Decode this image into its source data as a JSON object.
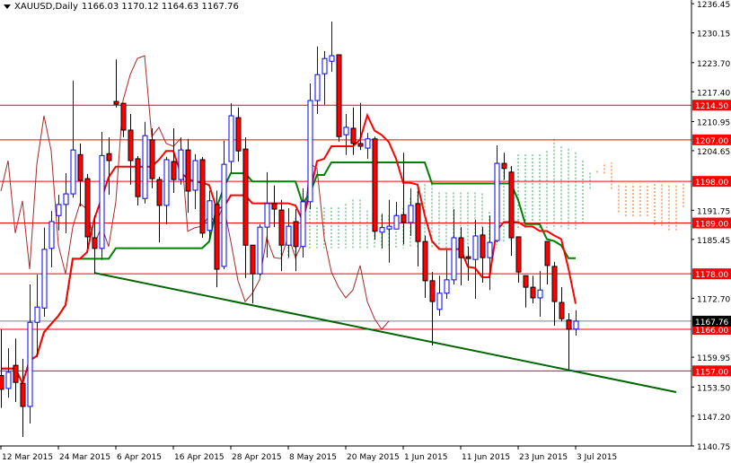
{
  "header": {
    "symbol": "XAUUSD,Daily",
    "ohlc_text": "1166.03 1170.12 1164.63 1167.76"
  },
  "colors": {
    "bull": "#0000ff",
    "bear": "#ff0000",
    "tenkan": "#ff0000",
    "kijun": "#008000",
    "chikou": "#a52a2a",
    "cloud_bear": "#ff6600",
    "cloud_bull": "#33aa55",
    "level": "#ff0000",
    "trendline": "#006400",
    "price_line": "#708090"
  },
  "chart_data": {
    "type": "candlestick",
    "title": "XAUUSD,Daily",
    "ylim": [
      1140.75,
      1236.45
    ],
    "y_ticks": [
      "1236.45",
      "1230.15",
      "1223.70",
      "1217.40",
      "1210.95",
      "1204.65",
      "1191.75",
      "1185.45",
      "1172.70",
      "1159.95",
      "1153.50",
      "1147.20",
      "1140.75"
    ],
    "x_ticks": [
      {
        "bar": 0,
        "label": "12 Mar 2015"
      },
      {
        "bar": 8,
        "label": "24 Mar 2015"
      },
      {
        "bar": 16,
        "label": "6 Apr 2015"
      },
      {
        "bar": 24,
        "label": "16 Apr 2015"
      },
      {
        "bar": 32,
        "label": "28 Apr 2015"
      },
      {
        "bar": 40,
        "label": "8 May 2015"
      },
      {
        "bar": 48,
        "label": "20 May 2015"
      },
      {
        "bar": 56,
        "label": "1 Jun 2015"
      },
      {
        "bar": 64,
        "label": "11 Jun 2015"
      },
      {
        "bar": 72,
        "label": "23 Jun 2015"
      },
      {
        "bar": 80,
        "label": "3 Jul 2015"
      }
    ],
    "levels": [
      "1214.50",
      "1207.00",
      "1198.00",
      "1189.00",
      "1178.00",
      "1166.00",
      "1157.00"
    ],
    "current_price": "1167.76",
    "trendline": {
      "from": [
        13,
        1178.2
      ],
      "to": [
        94,
        1152.4
      ]
    },
    "ohlc": [
      [
        1156,
        1166,
        1149,
        1153
      ],
      [
        1153.2,
        1161.9,
        1151.2,
        1156.7
      ],
      [
        1158.2,
        1164,
        1150.3,
        1154.5
      ],
      [
        1154.3,
        1159.6,
        1142.7,
        1149.3
      ],
      [
        1149.3,
        1175.7,
        1145.6,
        1167.5
      ],
      [
        1167.5,
        1177.8,
        1160,
        1170.8
      ],
      [
        1170.6,
        1188,
        1168.7,
        1183.3
      ],
      [
        1183.5,
        1191.6,
        1179.4,
        1189.3
      ],
      [
        1190.6,
        1195.1,
        1187.4,
        1193
      ],
      [
        1193,
        1199.8,
        1186.8,
        1195.3
      ],
      [
        1195.3,
        1219.8,
        1194.5,
        1204.8
      ],
      [
        1203.8,
        1206.2,
        1192.6,
        1198.2
      ],
      [
        1198.6,
        1199.6,
        1183.5,
        1186
      ],
      [
        1185.8,
        1190.6,
        1178,
        1183.5
      ],
      [
        1183.5,
        1208.7,
        1181,
        1203.6
      ],
      [
        1204,
        1207.5,
        1195.1,
        1202.5
      ],
      [
        1215.3,
        1224.4,
        1214,
        1214.7
      ],
      [
        1214.9,
        1214.9,
        1207.6,
        1209.1
      ],
      [
        1209.1,
        1212.6,
        1197.3,
        1202.5
      ],
      [
        1202.9,
        1203.5,
        1192.8,
        1194.7
      ],
      [
        1194.3,
        1210.9,
        1193.2,
        1207.9
      ],
      [
        1207,
        1209.5,
        1196.5,
        1198.6
      ],
      [
        1198.4,
        1199,
        1184.8,
        1192.8
      ],
      [
        1192.8,
        1203.3,
        1188.7,
        1202.7
      ],
      [
        1202.3,
        1209.5,
        1195.5,
        1198.4
      ],
      [
        1198.4,
        1207.5,
        1197.3,
        1204.8
      ],
      [
        1204.8,
        1207.2,
        1191.2,
        1195.9
      ],
      [
        1196.1,
        1203.9,
        1192,
        1202.5
      ],
      [
        1202.7,
        1203.3,
        1185.8,
        1186.8
      ],
      [
        1187.4,
        1196,
        1185.4,
        1193.8
      ],
      [
        1193,
        1196,
        1175.1,
        1179
      ],
      [
        1179.6,
        1206.8,
        1179,
        1201.7
      ],
      [
        1202.3,
        1214.9,
        1199.8,
        1212.2
      ],
      [
        1211.8,
        1214,
        1202.3,
        1204.6
      ],
      [
        1205,
        1207.5,
        1177.1,
        1184.2
      ],
      [
        1184.2,
        1184.2,
        1171.6,
        1178
      ],
      [
        1178,
        1188.7,
        1177.6,
        1188.1
      ],
      [
        1188.1,
        1200,
        1181.5,
        1193.2
      ],
      [
        1193.2,
        1197.1,
        1188.1,
        1192
      ],
      [
        1191.8,
        1194,
        1178.6,
        1184.2
      ],
      [
        1184.2,
        1192.2,
        1181.5,
        1188.3
      ],
      [
        1189.3,
        1192,
        1178.6,
        1183.9
      ],
      [
        1183.9,
        1196.5,
        1181.5,
        1193.6
      ],
      [
        1193.6,
        1219.2,
        1192,
        1215.5
      ],
      [
        1215.5,
        1227.2,
        1212.6,
        1221.1
      ],
      [
        1221.3,
        1226.2,
        1214.6,
        1224.6
      ],
      [
        1224,
        1232.6,
        1221.7,
        1225.2
      ],
      [
        1225.4,
        1225.4,
        1206.6,
        1207.7
      ],
      [
        1208.1,
        1212.6,
        1203.7,
        1209.7
      ],
      [
        1209.5,
        1214,
        1203.7,
        1206.2
      ],
      [
        1206.2,
        1215,
        1204.8,
        1205.6
      ],
      [
        1205.2,
        1208.5,
        1202.9,
        1207.2
      ],
      [
        1207.2,
        1207.7,
        1185.4,
        1187.2
      ],
      [
        1187,
        1191,
        1183.5,
        1188
      ],
      [
        1187.7,
        1194,
        1180.4,
        1188.3
      ],
      [
        1187.7,
        1193.6,
        1187.7,
        1190.6
      ],
      [
        1190.8,
        1204.2,
        1184.4,
        1189.1
      ],
      [
        1189.1,
        1196.5,
        1186.2,
        1192.8
      ],
      [
        1193.2,
        1196,
        1179.6,
        1185
      ],
      [
        1185,
        1186.2,
        1172.8,
        1176.5
      ],
      [
        1176.5,
        1178.4,
        1162.5,
        1172
      ],
      [
        1170.3,
        1177.6,
        1168.9,
        1173.8
      ],
      [
        1173.8,
        1183.1,
        1172.6,
        1176.7
      ],
      [
        1176.7,
        1192,
        1175.7,
        1185.8
      ],
      [
        1185.8,
        1188.1,
        1175.5,
        1181.5
      ],
      [
        1181.7,
        1183.9,
        1176.5,
        1181.3
      ],
      [
        1181.1,
        1189.7,
        1172.6,
        1186.2
      ],
      [
        1186.4,
        1188.1,
        1176.1,
        1181.5
      ],
      [
        1181.5,
        1190.6,
        1174.5,
        1184.8
      ],
      [
        1185.2,
        1205.8,
        1184.8,
        1201.9
      ],
      [
        1201.9,
        1204.2,
        1198.4,
        1200.8
      ],
      [
        1200,
        1201.3,
        1181.9,
        1185.8
      ],
      [
        1186,
        1186,
        1176.1,
        1178.4
      ],
      [
        1177.6,
        1177.6,
        1170.7,
        1175.1
      ],
      [
        1175.1,
        1177.6,
        1171.6,
        1172.8
      ],
      [
        1172.8,
        1178.6,
        1168.7,
        1174.5
      ],
      [
        1185,
        1185,
        1175.7,
        1179.8
      ],
      [
        1179.6,
        1180.6,
        1166.8,
        1172
      ],
      [
        1171.8,
        1175.1,
        1167.7,
        1168.3
      ],
      [
        1168,
        1169.5,
        1157,
        1166
      ],
      [
        1166.03,
        1170.12,
        1164.63,
        1167.76
      ]
    ]
  }
}
